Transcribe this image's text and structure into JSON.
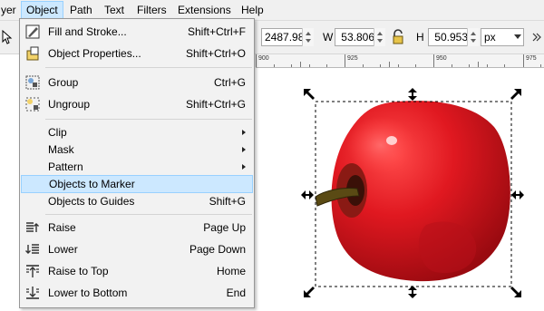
{
  "menubar": {
    "items": [
      {
        "label": "yer",
        "active": false
      },
      {
        "label": "Object",
        "active": true
      },
      {
        "label": "Path",
        "active": false
      },
      {
        "label": "Text",
        "active": false
      },
      {
        "label": "Filters",
        "active": false
      },
      {
        "label": "Extensions",
        "active": false
      },
      {
        "label": "Help",
        "active": false
      }
    ]
  },
  "toolbar": {
    "x_value": "2487.98",
    "w_label": "W",
    "w_value": "53.806",
    "h_label": "H",
    "h_value": "50.953",
    "unit": "px",
    "lock_icon": "lock-icon"
  },
  "ruler": {
    "labels": [
      "900",
      "925",
      "950",
      "975"
    ]
  },
  "object_menu": {
    "items": [
      {
        "label": "Fill and Stroke...",
        "shortcut": "Shift+Ctrl+F",
        "icon": "fill-stroke-icon"
      },
      {
        "label": "Object Properties...",
        "shortcut": "Shift+Ctrl+O",
        "icon": "object-properties-icon"
      },
      {
        "label": "Group",
        "shortcut": "Ctrl+G",
        "icon": "group-icon"
      },
      {
        "label": "Ungroup",
        "shortcut": "Shift+Ctrl+G",
        "icon": "ungroup-icon"
      },
      {
        "label": "Clip",
        "shortcut": "",
        "submenu": true
      },
      {
        "label": "Mask",
        "shortcut": "",
        "submenu": true
      },
      {
        "label": "Pattern",
        "shortcut": "",
        "submenu": true
      },
      {
        "label": "Objects to Marker",
        "shortcut": "",
        "highlighted": true
      },
      {
        "label": "Objects to Guides",
        "shortcut": "Shift+G"
      },
      {
        "label": "Raise",
        "shortcut": "Page Up",
        "icon": "raise-icon"
      },
      {
        "label": "Lower",
        "shortcut": "Page Down",
        "icon": "lower-icon"
      },
      {
        "label": "Raise to Top",
        "shortcut": "Home",
        "icon": "raise-to-top-icon"
      },
      {
        "label": "Lower to Bottom",
        "shortcut": "End",
        "icon": "lower-to-bottom-icon"
      }
    ]
  },
  "colors": {
    "highlight": "#cce8ff",
    "highlight_border": "#99d1ff",
    "apple_red": "#d8141c",
    "apple_stem": "#4a3a10"
  }
}
